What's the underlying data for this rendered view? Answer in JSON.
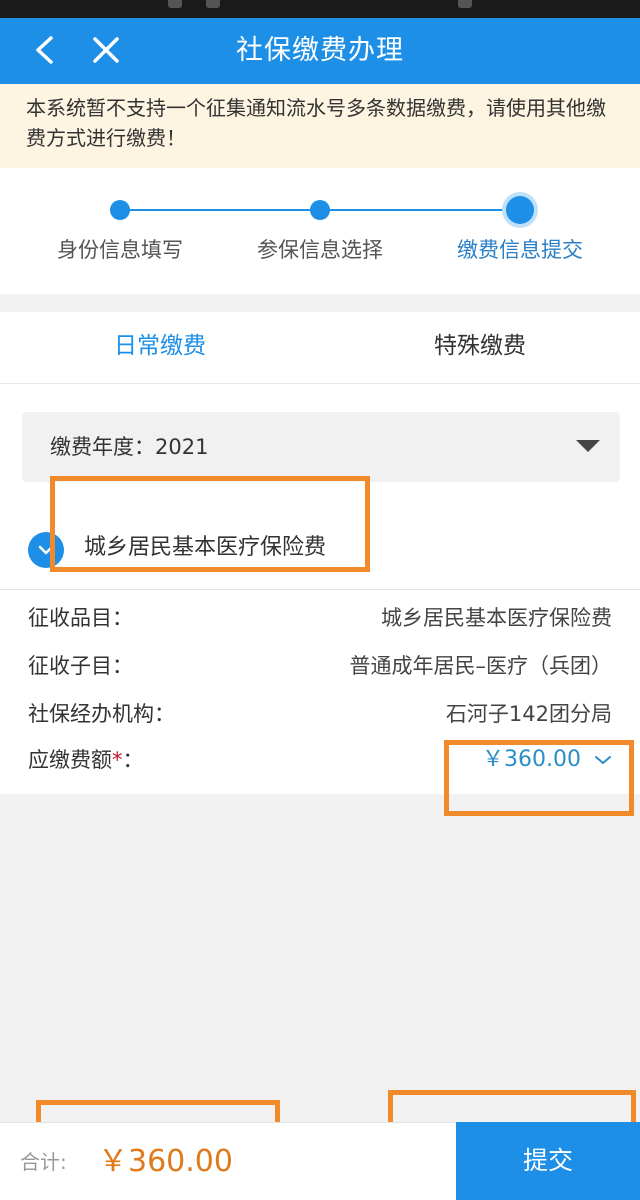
{
  "nav": {
    "title": "社保缴费办理"
  },
  "notice": "本系统暂不支持一个征集通知流水号多条数据缴费，请使用其他缴费方式进行缴费！",
  "steps": [
    {
      "label": "身份信息填写"
    },
    {
      "label": "参保信息选择"
    },
    {
      "label": "缴费信息提交"
    }
  ],
  "tabs": [
    {
      "label": "日常缴费"
    },
    {
      "label": "特殊缴费"
    }
  ],
  "year_select": {
    "text": "缴费年度：2021"
  },
  "insurance_option": {
    "label": "城乡居民基本医疗保险费",
    "checked": true
  },
  "details": {
    "item_label": "征收品目：",
    "item_value": "城乡居民基本医疗保险费",
    "subitem_label": "征收子目：",
    "subitem_value": "普通成年居民–医疗（兵团）",
    "agency_label": "社保经办机构：",
    "agency_value": "石河子142团分局",
    "amount_label": "应缴费额",
    "amount_required": "*",
    "amount_colon": "：",
    "amount_value": "￥360.00"
  },
  "footer": {
    "total_label": "合计:",
    "total_value": "￥360.00",
    "submit_label": "提交"
  },
  "colors": {
    "primary": "#1e8fe6",
    "highlight": "#f08a2a",
    "total": "#e07a1a",
    "notice_bg": "#fdf4e2"
  }
}
